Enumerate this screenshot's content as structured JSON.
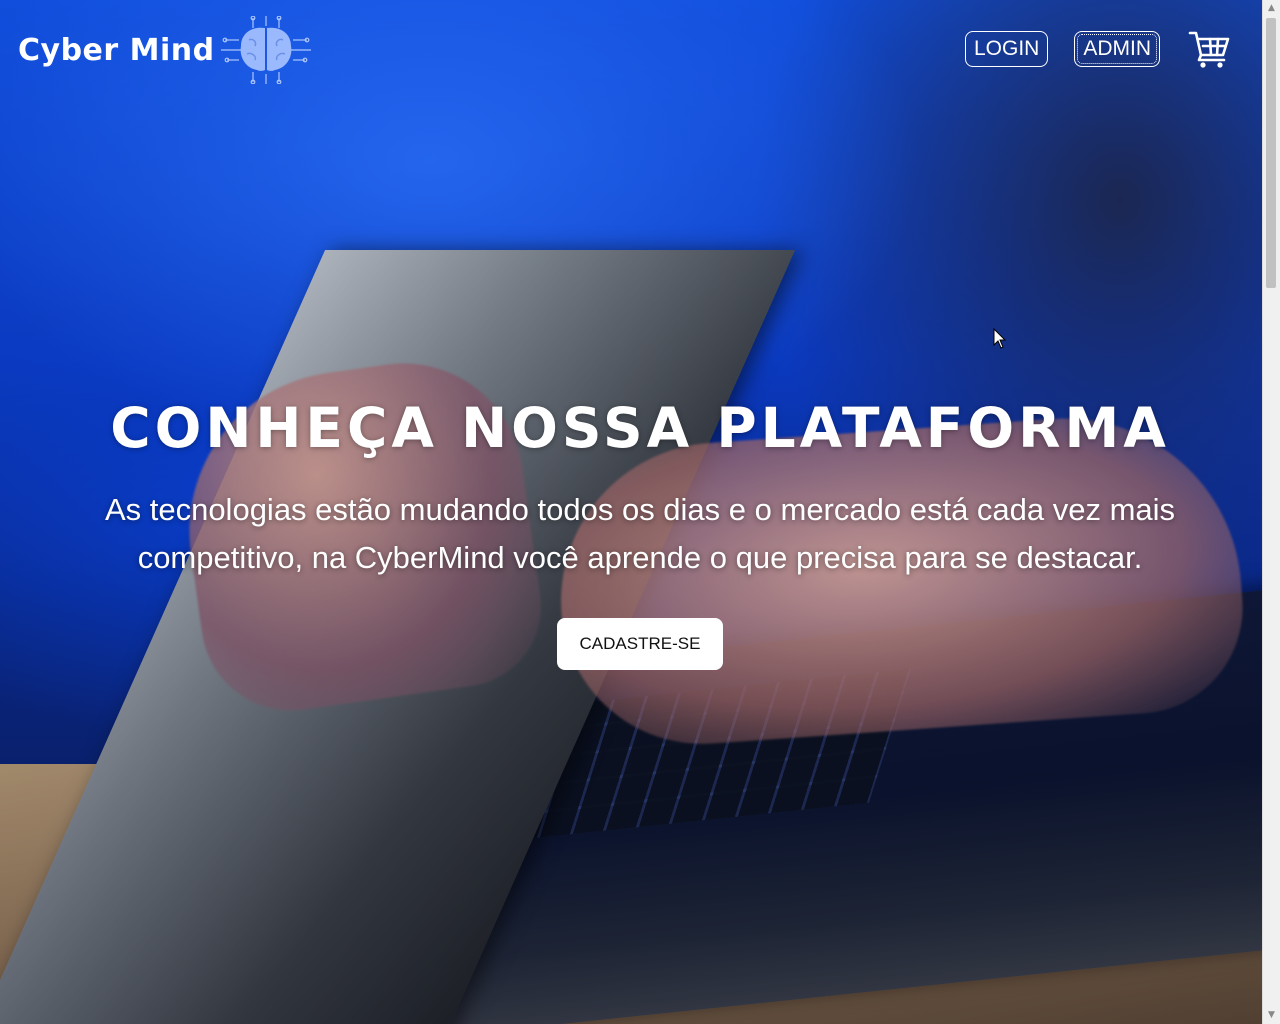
{
  "header": {
    "brand_name": "Cyber Mind",
    "brand_logo_icon": "brain-circuit-icon",
    "nav": {
      "login_label": "LOGIN",
      "admin_label": "ADMIN",
      "cart_icon": "shopping-cart-icon"
    }
  },
  "hero": {
    "title": "CONHEÇA NOSSA PLATAFORMA",
    "subtitle": "As tecnologias estão mudando todos os dias e o mercado está cada vez mais competitivo, na CyberMind você aprende o que precisa para se destacar.",
    "cta_label": "CADASTRE-SE",
    "background_image": "hands-typing-on-laptop"
  },
  "colors": {
    "background_blue": "#1152e6",
    "text_white": "#ffffff",
    "cta_background": "#ffffff",
    "cta_text": "#111111"
  }
}
